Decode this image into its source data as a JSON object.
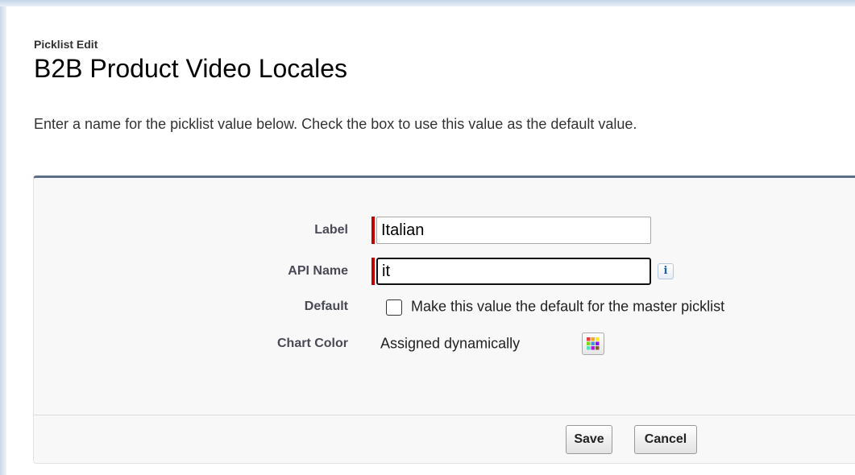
{
  "header": {
    "breadcrumb": "Picklist Edit",
    "title": "B2B Product Video Locales"
  },
  "instructions": "Enter a name for the picklist value below. Check the box to use this value as the default value.",
  "form": {
    "label_field": {
      "label": "Label",
      "value": "Italian"
    },
    "api_name_field": {
      "label": "API Name",
      "value": "it",
      "info_glyph": "i"
    },
    "default_field": {
      "label": "Default",
      "checkbox_label": "Make this value the default for the master picklist",
      "checked": false
    },
    "chart_color_field": {
      "label": "Chart Color",
      "value": "Assigned dynamically",
      "icon": "color-palette-icon"
    }
  },
  "buttons": {
    "save_label": "Save",
    "cancel_label": "Cancel"
  },
  "colors": {
    "required": "#c00000",
    "panel_border": "#5c6e86",
    "panel_background": "#f8f8f8",
    "info_icon": "#1f5ea8",
    "palette": [
      "#e83d3d",
      "#f5a623",
      "#f8e71c",
      "#7ed321",
      "#4a90e2",
      "#9013fe",
      "#50e3c2",
      "#bd10e0",
      "#8b572a"
    ]
  }
}
